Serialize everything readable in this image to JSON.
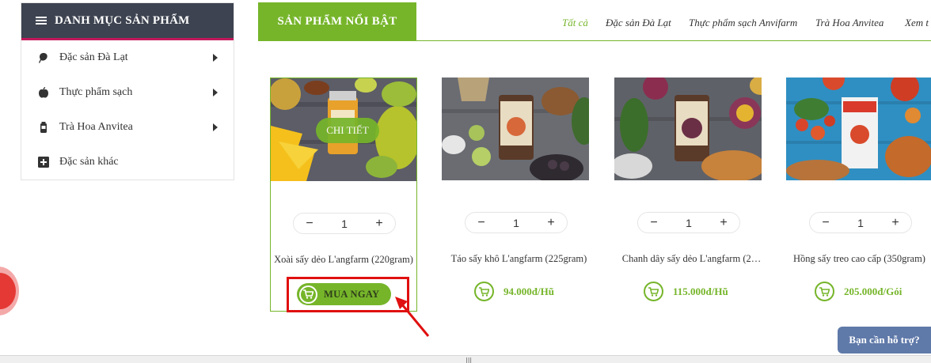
{
  "sidebar": {
    "title": "DANH MỤC SẢN PHẨM",
    "items": [
      {
        "label": "Đặc sản Đà Lạt",
        "icon": "leaf-icon"
      },
      {
        "label": "Thực phẩm sạch",
        "icon": "apple-icon"
      },
      {
        "label": "Trà Hoa Anvitea",
        "icon": "tea-bottle-icon"
      },
      {
        "label": "Đặc sản khác",
        "icon": "plus-box-icon"
      }
    ]
  },
  "featured": {
    "tab_label": "SẢN PHẨM NỔI BẬT",
    "filters": [
      "Tất cả",
      "Đặc sản Đà Lạt",
      "Thực phẩm sạch Anvifarm",
      "Trà Hoa Anvitea",
      "Xem t"
    ]
  },
  "products": [
    {
      "name": "Xoài sấy dẻo L'angfarm (220gram)",
      "qty": "1",
      "detail_label": "CHI TIẾT",
      "buy_label": "MUA NGAY"
    },
    {
      "name": "Táo sấy khô L'angfarm (225gram)",
      "qty": "1",
      "price": "94.000đ/Hũ"
    },
    {
      "name": "Chanh dây sấy dẻo L'angfarm (2…",
      "qty": "1",
      "price": "115.000đ/Hũ"
    },
    {
      "name": "Hồng sấy treo cao cấp (350gram)",
      "qty": "1",
      "price": "205.000đ/Gói"
    }
  ],
  "qty_controls": {
    "minus": "−",
    "plus": "+"
  },
  "help": {
    "label": "Bạn cần hỗ trợ?"
  },
  "colors": {
    "accent": "#76b52a",
    "sidebar_header": "#3d4350",
    "highlight": "#e01010",
    "help": "#5f79a9"
  }
}
